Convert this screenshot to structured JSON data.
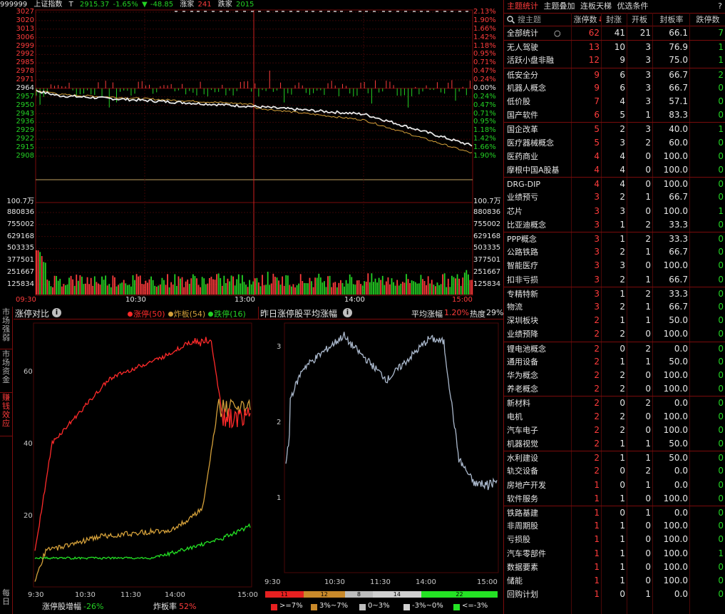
{
  "index_header": {
    "code": "999999",
    "name": "上证指数",
    "t_label": "T",
    "price": "2915.37",
    "change_pct": "-1.65%",
    "change_arrow": "▼",
    "change": "-48.85",
    "up_label": "涨家",
    "up_count": "241",
    "down_label": "跌家",
    "down_count": "2015"
  },
  "price_axis": {
    "left": [
      "3027",
      "3020",
      "3013",
      "3006",
      "2999",
      "2992",
      "2985",
      "2978",
      "2971",
      "2964",
      "2957",
      "2950",
      "2943",
      "2936",
      "2929",
      "2922",
      "2915",
      "2908"
    ],
    "right": [
      "2.13%",
      "1.90%",
      "1.66%",
      "1.42%",
      "1.18%",
      "0.95%",
      "0.71%",
      "0.47%",
      "0.24%",
      "0.00%",
      "0.24%",
      "0.47%",
      "0.71%",
      "0.95%",
      "1.18%",
      "1.42%",
      "1.66%",
      "1.90%"
    ],
    "vol_unit_left": "100.7万",
    "vol_unit_right": "100.7万",
    "vol_left": [
      "880836",
      "755002",
      "629168",
      "503335",
      "377501",
      "251667",
      "125834"
    ],
    "vol_right": [
      "880836",
      "755002",
      "629168",
      "503335",
      "377501",
      "251667",
      "125834"
    ],
    "time_labels": [
      "09:30",
      "10:30",
      "13:00",
      "14:00",
      "15:00"
    ]
  },
  "side_tabs": [
    "市场强弱",
    "市场资金",
    "赚钱效应",
    "每日"
  ],
  "limit_panel": {
    "title": "涨停对比",
    "info_icon": "info-icon",
    "legend": [
      {
        "label": "涨停",
        "count": "(50)",
        "color": "#ff2a2a"
      },
      {
        "label": "炸板",
        "count": "(54)",
        "color": "#d4a03a"
      },
      {
        "label": "跌停",
        "count": "(16)",
        "color": "#24d224"
      }
    ],
    "y_ticks": [
      "60",
      "40",
      "20"
    ],
    "x_ticks": [
      "9:30",
      "10:30",
      "11:30",
      "14:00",
      "15:00"
    ],
    "footer_label1": "涨停股增幅",
    "footer_value1": "-26%",
    "footer_label2": "炸板率",
    "footer_value2": "52%"
  },
  "yest_panel": {
    "title": "昨日涨停股平均涨幅",
    "info_icon": "info-icon",
    "avg_label": "平均涨幅",
    "avg_value": "1.20%",
    "heat_label": "热度",
    "heat_value": "29%",
    "y_ticks": [
      "3",
      "2",
      "1"
    ],
    "x_ticks": [
      "9:30",
      "10:30",
      "11:30",
      "14:00",
      "15:00"
    ],
    "dist_bar": [
      {
        "value": "11",
        "color": "#e62020",
        "share": 11
      },
      {
        "value": "12",
        "color": "#c8892a",
        "share": 12
      },
      {
        "value": "8",
        "color": "#bdbdbd",
        "share": 8
      },
      {
        "value": "14",
        "color": "#d0d0d0",
        "share": 14
      },
      {
        "value": "22",
        "color": "#24e224",
        "share": 22
      }
    ],
    "dist_legend": [
      {
        "label": ">=7%",
        "color": "#e62020"
      },
      {
        "label": "3%~7%",
        "color": "#c8892a"
      },
      {
        "label": "0~3%",
        "color": "#bdbdbd"
      },
      {
        "label": "-3%~0%",
        "color": "#d0d0d0"
      },
      {
        "label": "<=-3%",
        "color": "#24e224"
      }
    ]
  },
  "right_panel": {
    "tabs": [
      "主题统计",
      "主题叠加",
      "连板天梯",
      "优选条件"
    ],
    "help": "?",
    "search_placeholder": "搜主题",
    "headers": [
      "涨停数",
      "封涨",
      "开板",
      "封板率",
      "跌停数"
    ],
    "sort_arrow": "↓",
    "rows": [
      {
        "name": "全部统计",
        "c1": "62",
        "c2": "41",
        "c3": "21",
        "c4": "66.1",
        "c5": "7",
        "sep": false,
        "extra": "○"
      },
      {
        "name": "无人驾驶",
        "c1": "13",
        "c2": "10",
        "c3": "3",
        "c4": "76.9",
        "c5": "1",
        "sep": true
      },
      {
        "name": "活跃小盘非融",
        "c1": "12",
        "c2": "9",
        "c3": "3",
        "c4": "75.0",
        "c5": "1",
        "sep": false
      },
      {
        "name": "低安全分",
        "c1": "9",
        "c2": "6",
        "c3": "3",
        "c4": "66.7",
        "c5": "2",
        "sep": true
      },
      {
        "name": "机器人概念",
        "c1": "9",
        "c2": "6",
        "c3": "3",
        "c4": "66.7",
        "c5": "0",
        "sep": false
      },
      {
        "name": "低价股",
        "c1": "7",
        "c2": "4",
        "c3": "3",
        "c4": "57.1",
        "c5": "0",
        "sep": false
      },
      {
        "name": "国产软件",
        "c1": "6",
        "c2": "5",
        "c3": "1",
        "c4": "83.3",
        "c5": "0",
        "sep": false
      },
      {
        "name": "国企改革",
        "c1": "5",
        "c2": "2",
        "c3": "3",
        "c4": "40.0",
        "c5": "1",
        "sep": true
      },
      {
        "name": "医疗器械概念",
        "c1": "5",
        "c2": "3",
        "c3": "2",
        "c4": "60.0",
        "c5": "0",
        "sep": false
      },
      {
        "name": "医药商业",
        "c1": "4",
        "c2": "4",
        "c3": "0",
        "c4": "100.0",
        "c5": "0",
        "sep": false
      },
      {
        "name": "摩根中国A股基",
        "c1": "4",
        "c2": "4",
        "c3": "0",
        "c4": "100.0",
        "c5": "0",
        "sep": false
      },
      {
        "name": "DRG-DIP",
        "c1": "4",
        "c2": "4",
        "c3": "0",
        "c4": "100.0",
        "c5": "0",
        "sep": true
      },
      {
        "name": "业绩预亏",
        "c1": "3",
        "c2": "2",
        "c3": "1",
        "c4": "66.7",
        "c5": "0",
        "sep": false
      },
      {
        "name": "芯片",
        "c1": "3",
        "c2": "3",
        "c3": "0",
        "c4": "100.0",
        "c5": "1",
        "sep": false
      },
      {
        "name": "比亚迪概念",
        "c1": "3",
        "c2": "1",
        "c3": "2",
        "c4": "33.3",
        "c5": "0",
        "sep": false
      },
      {
        "name": "PPP概念",
        "c1": "3",
        "c2": "1",
        "c3": "2",
        "c4": "33.3",
        "c5": "0",
        "sep": true
      },
      {
        "name": "公路铁路",
        "c1": "3",
        "c2": "2",
        "c3": "1",
        "c4": "66.7",
        "c5": "0",
        "sep": false
      },
      {
        "name": "智能医疗",
        "c1": "3",
        "c2": "3",
        "c3": "0",
        "c4": "100.0",
        "c5": "0",
        "sep": false
      },
      {
        "name": "扣非亏损",
        "c1": "3",
        "c2": "2",
        "c3": "1",
        "c4": "66.7",
        "c5": "0",
        "sep": false
      },
      {
        "name": "专精特新",
        "c1": "3",
        "c2": "1",
        "c3": "2",
        "c4": "33.3",
        "c5": "0",
        "sep": true
      },
      {
        "name": "物流",
        "c1": "3",
        "c2": "2",
        "c3": "1",
        "c4": "66.7",
        "c5": "0",
        "sep": false
      },
      {
        "name": "深圳板块",
        "c1": "2",
        "c2": "1",
        "c3": "1",
        "c4": "50.0",
        "c5": "0",
        "sep": false
      },
      {
        "name": "业绩预降",
        "c1": "2",
        "c2": "2",
        "c3": "0",
        "c4": "100.0",
        "c5": "0",
        "sep": false
      },
      {
        "name": "锂电池概念",
        "c1": "2",
        "c2": "0",
        "c3": "2",
        "c4": "0.0",
        "c5": "0",
        "sep": true
      },
      {
        "name": "通用设备",
        "c1": "2",
        "c2": "1",
        "c3": "1",
        "c4": "50.0",
        "c5": "0",
        "sep": false
      },
      {
        "name": "华为概念",
        "c1": "2",
        "c2": "2",
        "c3": "0",
        "c4": "100.0",
        "c5": "0",
        "sep": false
      },
      {
        "name": "养老概念",
        "c1": "2",
        "c2": "2",
        "c3": "0",
        "c4": "100.0",
        "c5": "0",
        "sep": false
      },
      {
        "name": "新材料",
        "c1": "2",
        "c2": "0",
        "c3": "2",
        "c4": "0.0",
        "c5": "0",
        "sep": true
      },
      {
        "name": "电机",
        "c1": "2",
        "c2": "2",
        "c3": "0",
        "c4": "100.0",
        "c5": "0",
        "sep": false
      },
      {
        "name": "汽车电子",
        "c1": "2",
        "c2": "2",
        "c3": "0",
        "c4": "100.0",
        "c5": "0",
        "sep": false
      },
      {
        "name": "机器视觉",
        "c1": "2",
        "c2": "1",
        "c3": "1",
        "c4": "50.0",
        "c5": "0",
        "sep": false
      },
      {
        "name": "水利建设",
        "c1": "2",
        "c2": "1",
        "c3": "1",
        "c4": "50.0",
        "c5": "0",
        "sep": true
      },
      {
        "name": "轨交设备",
        "c1": "2",
        "c2": "0",
        "c3": "2",
        "c4": "0.0",
        "c5": "0",
        "sep": false
      },
      {
        "name": "房地产开发",
        "c1": "1",
        "c2": "0",
        "c3": "1",
        "c4": "0.0",
        "c5": "0",
        "sep": false
      },
      {
        "name": "软件服务",
        "c1": "1",
        "c2": "1",
        "c3": "0",
        "c4": "100.0",
        "c5": "0",
        "sep": false
      },
      {
        "name": "铁路基建",
        "c1": "1",
        "c2": "0",
        "c3": "1",
        "c4": "0.0",
        "c5": "0",
        "sep": true
      },
      {
        "name": "非周期股",
        "c1": "1",
        "c2": "1",
        "c3": "0",
        "c4": "100.0",
        "c5": "0",
        "sep": false
      },
      {
        "name": "亏损股",
        "c1": "1",
        "c2": "1",
        "c3": "0",
        "c4": "100.0",
        "c5": "0",
        "sep": false
      },
      {
        "name": "汽车零部件",
        "c1": "1",
        "c2": "1",
        "c3": "0",
        "c4": "100.0",
        "c5": "1",
        "sep": false
      },
      {
        "name": "数据要素",
        "c1": "1",
        "c2": "1",
        "c3": "0",
        "c4": "100.0",
        "c5": "0",
        "sep": false
      },
      {
        "name": "储能",
        "c1": "1",
        "c2": "1",
        "c3": "0",
        "c4": "100.0",
        "c5": "0",
        "sep": false
      },
      {
        "name": "回购计划",
        "c1": "1",
        "c2": "0",
        "c3": "1",
        "c4": "0.0",
        "c5": "0",
        "sep": false
      }
    ]
  },
  "colors": {
    "price_line": "#e8e8e8",
    "avg_line": "#d4a03a",
    "up": "#ff3c3c",
    "down": "#24d224",
    "grid": "#7a0c0c",
    "yest_line": "#aab8cc"
  }
}
